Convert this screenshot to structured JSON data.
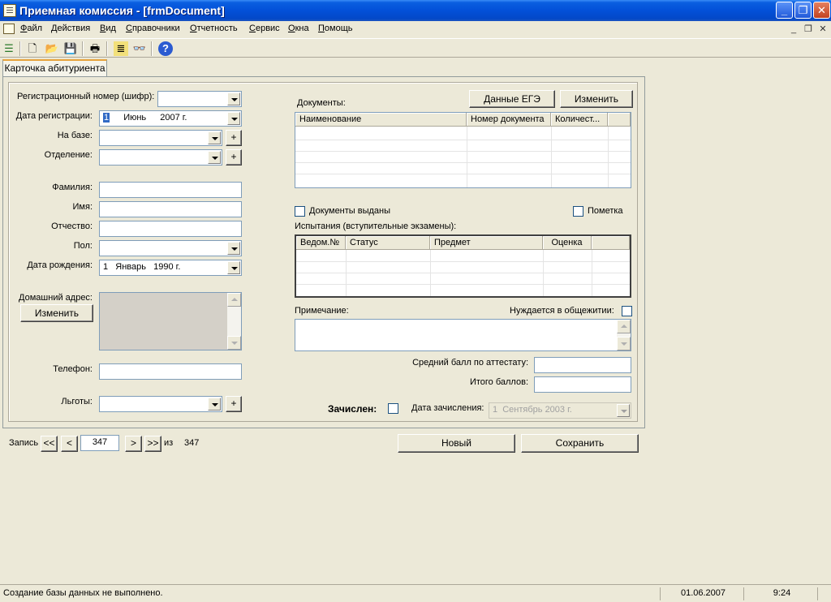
{
  "window": {
    "title": "Приемная комиссия - [frmDocument]",
    "min_glyph": "_",
    "max_glyph": "❐",
    "close_glyph": "✕"
  },
  "menu": {
    "items": [
      "Файл",
      "Действия",
      "Вид",
      "Справочники",
      "Отчетность",
      "Сервис",
      "Окна",
      "Помощь"
    ],
    "mdi_min": "_",
    "mdi_restore": "❐",
    "mdi_close": "✕"
  },
  "toolbar": {
    "icons": [
      "list-icon",
      "new-document-icon",
      "open-folder-icon",
      "save-disk-icon",
      "print-icon",
      "report-icon",
      "binoculars-find-icon",
      "help-icon"
    ],
    "glyphs": {
      "list": "☰",
      "new": "🗋",
      "open": "📂",
      "save": "💾",
      "print": "🖶",
      "report": "≣",
      "find": "👓",
      "help": "?"
    }
  },
  "tabs": [
    {
      "label": "Карточка абитуриента"
    }
  ],
  "form": {
    "reg_number_label": "Регистрационный номер (шифр):",
    "reg_number_value": "",
    "reg_date_label": "Дата регистрации:",
    "reg_date_day": "1",
    "reg_date_month": "Июнь",
    "reg_date_year": "2007 г.",
    "base_label": "На базе:",
    "base_value": "",
    "department_label": "Отделение:",
    "department_value": "",
    "plus": "+",
    "surname_label": "Фамилия:",
    "surname_value": "",
    "name_label": "Имя:",
    "name_value": "",
    "patronymic_label": "Отчество:",
    "patronymic_value": "",
    "gender_label": "Пол:",
    "gender_value": "",
    "birthdate_label": "Дата рождения:",
    "birthdate_value": "1   Январь   1990 г.",
    "address_label": "Домашний адрес:",
    "address_change_button": "Изменить",
    "phone_label": "Телефон:",
    "phone_value": "",
    "benefits_label": "Льготы:",
    "benefits_value": ""
  },
  "documents": {
    "label": "Документы:",
    "ege_button": "Данные ЕГЭ",
    "change_button": "Изменить",
    "columns": [
      "Наименование",
      "Номер документа",
      "Количест..."
    ],
    "rows": [],
    "issued_label": "Документы выданы",
    "mark_label": "Пометка"
  },
  "exams": {
    "label": "Испытания (вступительные экзамены):",
    "columns": [
      "Ведом.№",
      "Статус",
      "Предмет",
      "Оценка"
    ],
    "rows": []
  },
  "notes": {
    "label": "Примечание:",
    "dorm_label": "Нуждается  в общежитии:",
    "value": ""
  },
  "scores": {
    "avg_label": "Средний балл по аттестату:",
    "avg_value": "",
    "total_label": "Итого баллов:",
    "total_value": ""
  },
  "enrollment": {
    "enrolled_label": "Зачислен:",
    "date_label": "Дата зачисления:",
    "date_value": "1  Сентябрь 2003 г."
  },
  "navigator": {
    "record_label": "Запись",
    "first": "<<",
    "prev": "<",
    "current": "347",
    "next": ">",
    "last": ">>",
    "of_label": "из",
    "total": "347",
    "new_button": "Новый",
    "save_button": "Сохранить"
  },
  "status": {
    "message": "Создание базы данных не выполнено.",
    "date": "01.06.2007",
    "time": "9:24"
  },
  "colors": {
    "titlebar": "#0350d8",
    "face": "#ece9d8",
    "tab_accent": "#e6a33c",
    "input_border": "#7f9db9"
  }
}
